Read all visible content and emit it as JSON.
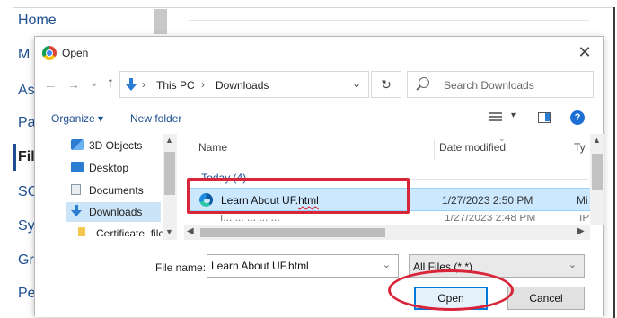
{
  "background_page": {
    "nav_items": [
      "Home",
      "M",
      "As",
      "Pa",
      "Fil",
      "SC",
      "Sy",
      "Gr",
      "Pe"
    ]
  },
  "dialog": {
    "title": "Open",
    "close_glyph": "✕",
    "address": {
      "back": "←",
      "forward": "→",
      "recent": "⌄",
      "up": "↑",
      "crumbs": [
        "This PC",
        "Downloads"
      ],
      "separator": "›",
      "dropdown": "⌄",
      "refresh": "↻"
    },
    "search": {
      "placeholder": "Search Downloads"
    },
    "toolbar": {
      "organize_label": "Organize ▾",
      "new_folder_label": "New folder",
      "view_dropdown": "▾",
      "help": "?"
    },
    "nav_pane": {
      "items": [
        {
          "label": "3D Objects",
          "icon": "3d-objects-icon",
          "selected": false
        },
        {
          "label": "Desktop",
          "icon": "desktop-icon",
          "selected": false
        },
        {
          "label": "Documents",
          "icon": "documents-icon",
          "selected": false
        },
        {
          "label": "Downloads",
          "icon": "downloads-icon",
          "selected": true
        },
        {
          "label": "Certificate_file",
          "icon": "folder-icon",
          "selected": false
        }
      ]
    },
    "file_list": {
      "columns": [
        "Name",
        "Date modified",
        "Ty"
      ],
      "group": "⌄ Today (4)",
      "files": [
        {
          "name_prefix": "Learn About UF.",
          "name_ext": "html",
          "date": "1/27/2023 2:50 PM",
          "type": "Mi",
          "selected": true
        },
        {
          "name": "I... ... ... ... ...",
          "date": "1/27/2023 2:48 PM",
          "type": "IP"
        }
      ]
    },
    "file_name": {
      "label": "File name:",
      "value": "Learn About UF.html"
    },
    "filter": {
      "value": "All Files (*.*)"
    },
    "buttons": {
      "open_label": "Open",
      "cancel_label": "Cancel"
    },
    "colors": {
      "accent": "#0078d7",
      "selection": "#cce8ff",
      "annotation_red": "#d9253a",
      "link_blue": "#1d4f91"
    }
  }
}
